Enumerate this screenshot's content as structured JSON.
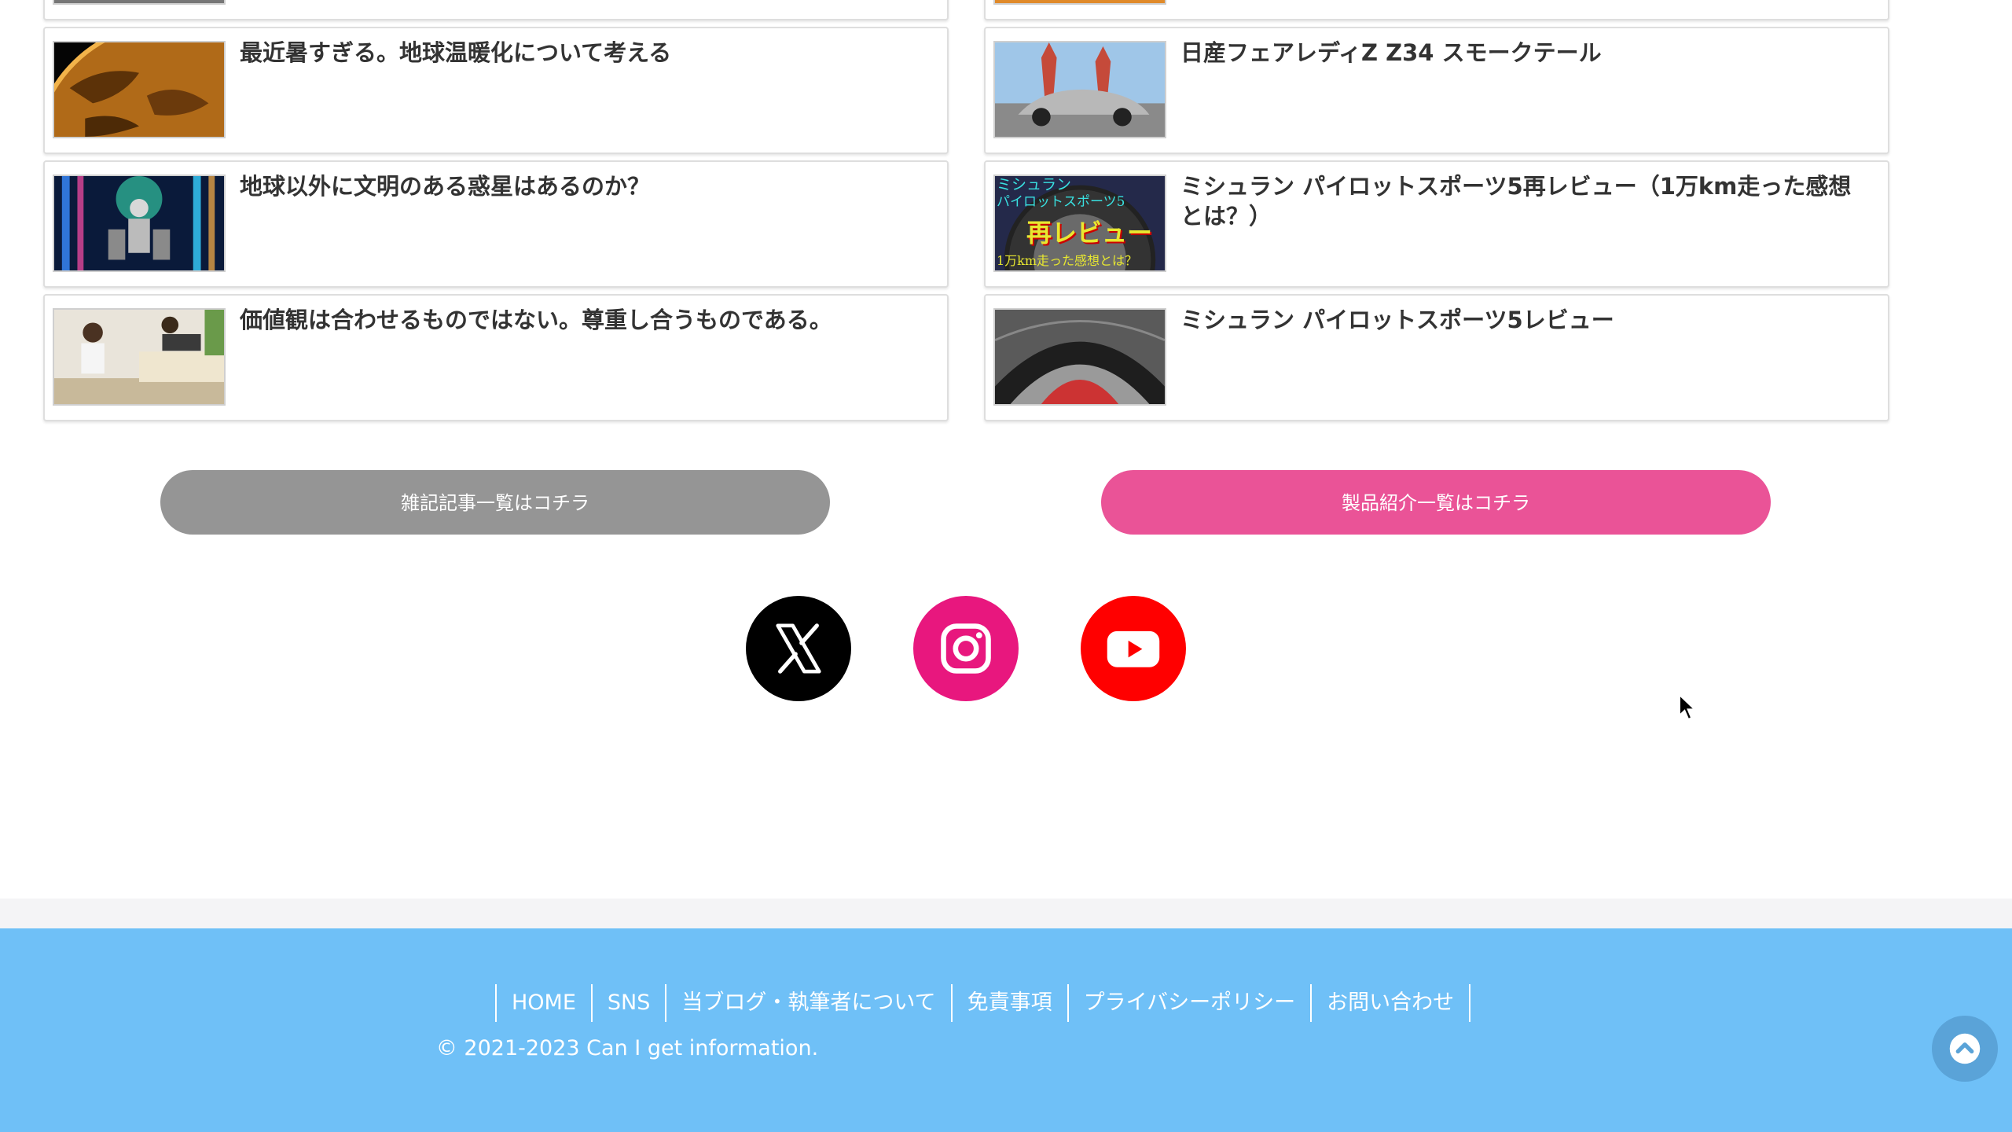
{
  "articles": {
    "left": [
      {
        "title": "最近暑すぎる。地球温暖化について考える",
        "thumb": "planet-thumbnail"
      },
      {
        "title": "地球以外に文明のある惑星はあるのか？",
        "thumb": "robot-thumbnail"
      },
      {
        "title": "価値観は合わせるものではない。尊重し合うものである。",
        "thumb": "couple-thumbnail"
      }
    ],
    "right": [
      {
        "title": "日産フェアレディZ Z34 スモークテール",
        "thumb": "car-thumbnail"
      },
      {
        "title": "ミシュラン パイロットスポーツ5再レビュー（1万km走った感想とは？）",
        "thumb": "tire-review-thumbnail",
        "thumb_text_top": "ミシュラン",
        "thumb_text_mid": "パイロットスポーツ5",
        "thumb_text_big": "再レビュー",
        "thumb_text_bottom": "1万km走った感想とは？"
      },
      {
        "title": "ミシュラン パイロットスポーツ5レビュー",
        "thumb": "tire-thumbnail"
      }
    ]
  },
  "buttons": {
    "misc_label": "雑記記事一覧はコチラ",
    "products_label": "製品紹介一覧はコチラ"
  },
  "sns": [
    {
      "name": "x-icon",
      "color": "#000000"
    },
    {
      "name": "instagram-icon",
      "color": "#e8177e"
    },
    {
      "name": "youtube-icon",
      "color": "#ff0000"
    }
  ],
  "colors": {
    "misc_button": "#959595",
    "products_button": "#ea5397",
    "footer": "#6fc0f7"
  },
  "footer": {
    "nav": [
      "HOME",
      "SNS",
      "当ブログ・執筆者について",
      "免責事項",
      "プライバシーポリシー",
      "お問い合わせ"
    ],
    "copyright": "© 2021-2023 Can I get information."
  }
}
